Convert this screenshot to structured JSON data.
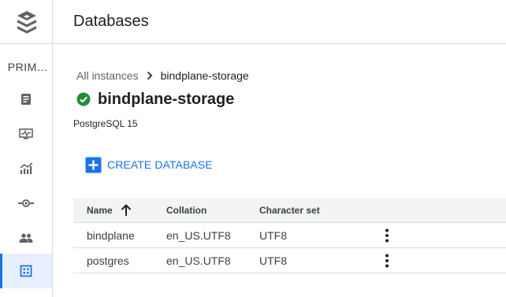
{
  "rail": {
    "project_label": "PRIM…",
    "items": [
      {
        "icon": "overview-icon"
      },
      {
        "icon": "monitoring-icon"
      },
      {
        "icon": "analytics-icon"
      },
      {
        "icon": "connections-icon"
      },
      {
        "icon": "users-icon"
      },
      {
        "icon": "databases-icon",
        "active": true
      }
    ]
  },
  "header": {
    "title": "Databases"
  },
  "breadcrumb": {
    "parent": "All instances",
    "current": "bindplane-storage"
  },
  "instance": {
    "name": "bindplane-storage",
    "status": "running",
    "version": "PostgreSQL 15"
  },
  "toolbar": {
    "create_label": "CREATE DATABASE"
  },
  "table": {
    "columns": [
      "Name",
      "Collation",
      "Character set"
    ],
    "rows": [
      {
        "name": "bindplane",
        "collation": "en_US.UTF8",
        "charset": "UTF8"
      },
      {
        "name": "postgres",
        "collation": "en_US.UTF8",
        "charset": "UTF8"
      }
    ]
  },
  "colors": {
    "accent": "#1a73e8",
    "success": "#1e8e3e",
    "header_row": "#f1f3f4",
    "active_nav": "#e8f0fe"
  }
}
